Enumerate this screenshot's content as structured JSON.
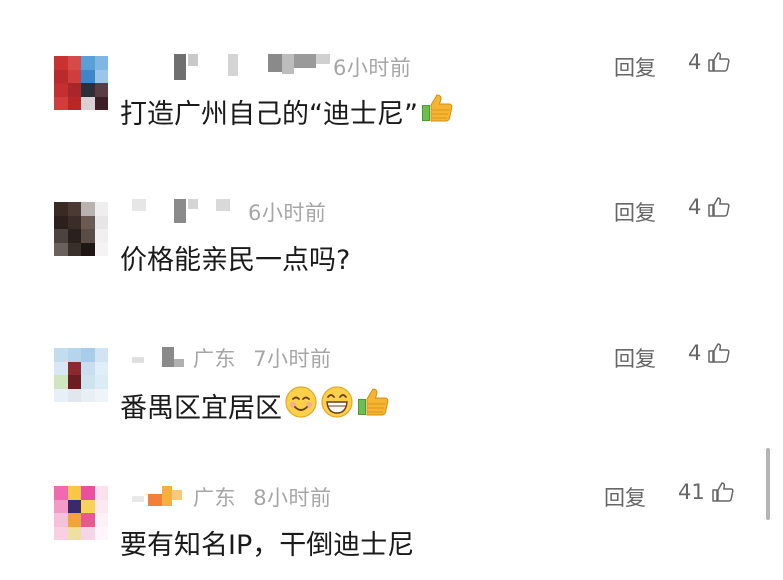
{
  "comments": [
    {
      "location": "",
      "time": "6小时前",
      "text": "打造广州自己的“迪士尼”",
      "reply_label": "回复",
      "likes": "4",
      "emojis": [
        "thumbs-up"
      ]
    },
    {
      "location": "",
      "time": "6小时前",
      "text": "价格能亲民一点吗?",
      "reply_label": "回复",
      "likes": "4",
      "emojis": []
    },
    {
      "location": "广东",
      "time": "7小时前",
      "text": "番禺区宜居区",
      "reply_label": "回复",
      "likes": "4",
      "emojis": [
        "smiling-face",
        "grinning-face",
        "thumbs-up"
      ]
    },
    {
      "location": "广东",
      "time": "8小时前",
      "text": "要有知名IP，干倒迪士尼",
      "reply_label": "回复",
      "likes": "41",
      "emojis": []
    }
  ],
  "colors": {
    "text": "#1a1a1a",
    "meta": "#a6a6a6",
    "action": "#666666"
  }
}
